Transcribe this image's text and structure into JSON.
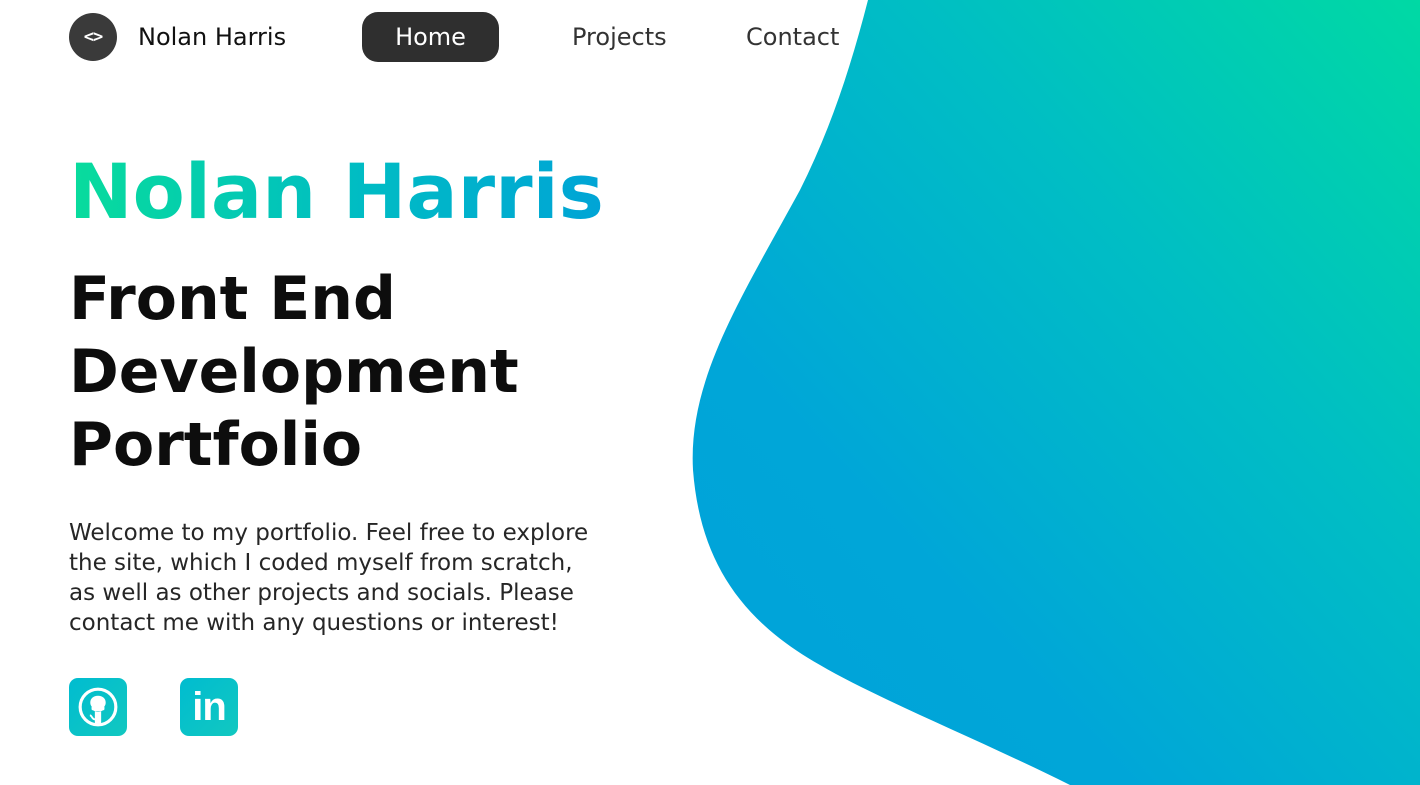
{
  "brand": {
    "logo_glyph": "<>",
    "name": "Nolan Harris",
    "logo_icon": "code-brackets-icon"
  },
  "nav": {
    "items": [
      {
        "label": "Home",
        "active": true
      },
      {
        "label": "Projects",
        "active": false
      },
      {
        "label": "Contact",
        "active": false
      }
    ]
  },
  "hero": {
    "name": "Nolan Harris",
    "heading_lines": [
      "Front End",
      "Development",
      "Portfolio"
    ],
    "intro_lines": [
      "Welcome to my portfolio. Feel free to explore",
      "the site, which I coded myself from scratch,",
      "as well as other projects and socials. Please",
      "contact me with any questions or interest!"
    ]
  },
  "socials": [
    {
      "icon": "github-icon"
    },
    {
      "icon": "linkedin-icon",
      "glyph": "in"
    }
  ],
  "colors": {
    "accent_green": "#08dc9c",
    "accent_blue": "#00a4d6",
    "nav_active_bg": "#2f2f2f",
    "text_dark": "#0d0d0d"
  }
}
